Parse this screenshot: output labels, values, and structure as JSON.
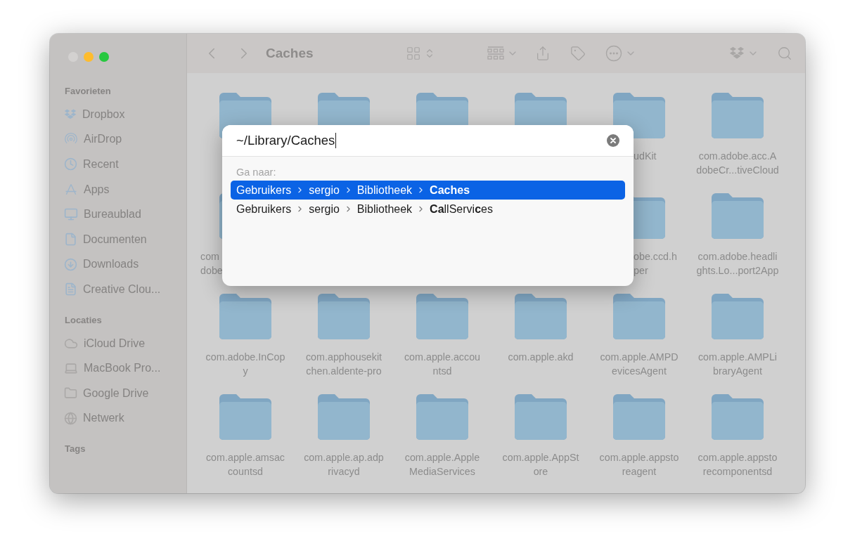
{
  "window": {
    "title": "Caches"
  },
  "sidebar": {
    "sections": [
      {
        "heading": "Favorieten",
        "items": [
          {
            "label": "Dropbox"
          },
          {
            "label": "AirDrop"
          },
          {
            "label": "Recent"
          },
          {
            "label": "Apps"
          },
          {
            "label": "Bureaublad"
          },
          {
            "label": "Documenten"
          },
          {
            "label": "Downloads"
          },
          {
            "label": "Creative Clou..."
          }
        ]
      },
      {
        "heading": "Locaties",
        "items": [
          {
            "label": "iCloud Drive"
          },
          {
            "label": "MacBook Pro..."
          },
          {
            "label": "Google Drive"
          },
          {
            "label": "Netwerk"
          }
        ]
      },
      {
        "heading": "Tags"
      }
    ]
  },
  "files": [
    {
      "kind": "folder"
    },
    {
      "kind": "folder"
    },
    {
      "kind": "folder"
    },
    {
      "kind": "folder"
    },
    {
      "kind": "folder-tail",
      "label_lines": [
        "udKit"
      ]
    },
    {
      "kind": "folder",
      "label_lines": [
        "com.adobe.acc.A",
        "dobeCr...tiveCloud"
      ]
    },
    {
      "kind": "folder-head",
      "label_lines": [
        "com",
        "dobe"
      ]
    },
    {
      "kind": "covered"
    },
    {
      "kind": "covered"
    },
    {
      "kind": "covered"
    },
    {
      "kind": "folder-tail",
      "label_lines": [
        "obe.ccd.h",
        "per"
      ]
    },
    {
      "kind": "folder",
      "label_lines": [
        "com.adobe.headli",
        "ghts.Lo...port2App"
      ]
    },
    {
      "kind": "folder",
      "label_lines": [
        "com.adobe.InCop",
        "y"
      ]
    },
    {
      "kind": "folder",
      "label_lines": [
        "com.apphousekit",
        "chen.aldente-pro"
      ]
    },
    {
      "kind": "folder",
      "label_lines": [
        "com.apple.accou",
        "ntsd"
      ]
    },
    {
      "kind": "folder",
      "label_lines": [
        "com.apple.akd"
      ]
    },
    {
      "kind": "folder",
      "label_lines": [
        "com.apple.AMPD",
        "evicesAgent"
      ]
    },
    {
      "kind": "folder",
      "label_lines": [
        "com.apple.AMPLi",
        "braryAgent"
      ]
    },
    {
      "kind": "folder",
      "label_lines": [
        "com.apple.amsac",
        "countsd"
      ]
    },
    {
      "kind": "folder",
      "label_lines": [
        "com.apple.ap.adp",
        "rivacyd"
      ]
    },
    {
      "kind": "folder",
      "label_lines": [
        "com.apple.Apple",
        "MediaServices"
      ]
    },
    {
      "kind": "folder",
      "label_lines": [
        "com.apple.AppSt",
        "ore"
      ]
    },
    {
      "kind": "folder",
      "label_lines": [
        "com.apple.appsto",
        "reagent"
      ]
    },
    {
      "kind": "folder",
      "label_lines": [
        "com.apple.appsto",
        "recomponentsd"
      ]
    }
  ],
  "go_to_dialog": {
    "path": "~/Library/Caches",
    "heading": "Ga naar:",
    "suggestions": [
      {
        "crumbs": [
          "Gebruikers",
          "sergio",
          "Bibliotheek"
        ],
        "target": "Caches",
        "target_bold": true,
        "selected": true
      },
      {
        "crumbs": [
          "Gebruikers",
          "sergio",
          "Bibliotheek"
        ],
        "target": "**Ca**llServi**c**es",
        "target_bold": false,
        "selected": false
      }
    ]
  }
}
